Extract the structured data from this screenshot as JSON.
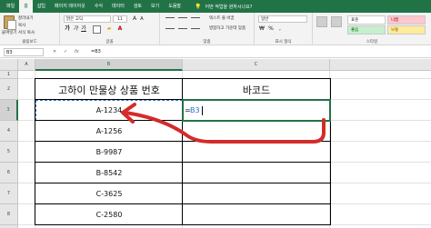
{
  "ribbon": {
    "tabs": [
      "파일",
      "홈",
      "삽입",
      "페이지 레이아웃",
      "수식",
      "데이터",
      "검토",
      "보기",
      "도움말"
    ],
    "active_tab": "홈",
    "tell_me": "어떤 작업을 원하시나요?",
    "clipboard": {
      "paste_label": "붙여넣기",
      "cut_label": "잘라내기",
      "copy_label": "복사",
      "format_painter_label": "서식 복사",
      "group_label": "클립보드"
    },
    "font": {
      "name": "맑은 고딕",
      "size": "11",
      "bold": "가",
      "italic": "가",
      "underline": "가",
      "group_label": "글꼴"
    },
    "alignment": {
      "wrap_label": "텍스트 줄 바꿈",
      "merge_label": "병합하고 가운데 맞춤",
      "group_label": "맞춤"
    },
    "number": {
      "format_value": "일반",
      "group_label": "표시 형식"
    },
    "styles": {
      "normal_label": "표준",
      "bad_label": "나쁨",
      "good_label": "좋음",
      "neutral_label": "보통",
      "group_label": "스타일"
    }
  },
  "formula_bar": {
    "name_box": "B3",
    "cancel": "✕",
    "enter": "✓",
    "fx": "fx",
    "formula": "=B3"
  },
  "sheet": {
    "columns": [
      "A",
      "B",
      "C"
    ],
    "rows": [
      "1",
      "2",
      "3",
      "4",
      "5",
      "6",
      "7",
      "8",
      "9"
    ],
    "header_b": "고하이 만물상 상품 번호",
    "header_c": "바코드",
    "products": [
      "A-1234",
      "A-1256",
      "B-9987",
      "B-8542",
      "C-3625",
      "C-2580"
    ],
    "editing": {
      "equals": "=",
      "ref": "B3"
    }
  },
  "colors": {
    "excel_green": "#217346",
    "reference_blue": "#2a72c9",
    "annotation_red": "#d42b2b"
  }
}
